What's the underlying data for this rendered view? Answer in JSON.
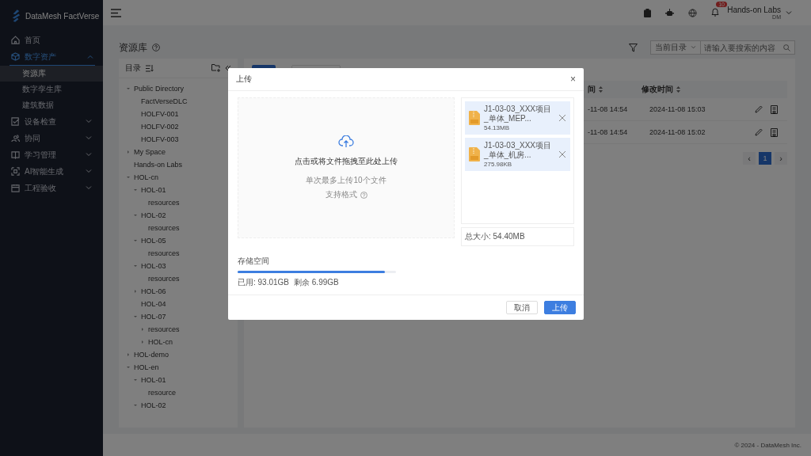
{
  "brand": {
    "name": "DataMesh FactVerse"
  },
  "nav": [
    {
      "label": "首页",
      "selected": false
    },
    {
      "label": "数字资产",
      "expanded": true,
      "selected": true,
      "children": [
        {
          "label": "资源库",
          "selected": true
        },
        {
          "label": "数字孪生库",
          "selected": false
        },
        {
          "label": "建筑数据",
          "selected": false
        }
      ]
    },
    {
      "label": "设备检查",
      "expanded": false,
      "selected": false
    },
    {
      "label": "协同",
      "expanded": false,
      "selected": false
    },
    {
      "label": "学习管理",
      "expanded": false,
      "selected": false
    },
    {
      "label": "AI智能生成",
      "expanded": false,
      "selected": false
    },
    {
      "label": "工程验收",
      "expanded": false,
      "selected": false
    }
  ],
  "header": {
    "notification_count": "10",
    "user": "Hands-on Labs",
    "user_sub": "DM"
  },
  "page": {
    "title": "资源库",
    "scope_select": "当前目录",
    "search": {
      "placeholder": "请输入要搜索的内容"
    }
  },
  "tree": {
    "title": "目录",
    "items": [
      {
        "label": "Public Directory",
        "expanded": true,
        "children": [
          {
            "label": "FactVerseDLC"
          },
          {
            "label": "HOLFV-001"
          },
          {
            "label": "HOLFV-002"
          },
          {
            "label": "HOLFV-003"
          }
        ]
      },
      {
        "label": "My Space",
        "expanded": false
      },
      {
        "label": "Hands-on Labs"
      },
      {
        "label": "HOL-cn",
        "expanded": true,
        "children": [
          {
            "label": "HOL-01",
            "expanded": true,
            "children": [
              {
                "label": "resources"
              }
            ]
          },
          {
            "label": "HOL-02",
            "expanded": true,
            "children": [
              {
                "label": "resources"
              }
            ]
          },
          {
            "label": "HOL-05",
            "expanded": true,
            "children": [
              {
                "label": "resources"
              }
            ]
          },
          {
            "label": "HOL-03",
            "expanded": true,
            "children": [
              {
                "label": "resources"
              }
            ]
          },
          {
            "label": "HOL-06",
            "expanded": false
          },
          {
            "label": "HOL-04"
          },
          {
            "label": "HOL-07",
            "expanded": true,
            "children": [
              {
                "label": "resources",
                "expanded": false
              },
              {
                "label": "HOL-cn",
                "expanded": false
              }
            ]
          }
        ]
      },
      {
        "label": "HOL-demo",
        "expanded": false
      },
      {
        "label": "HOL-en",
        "expanded": true,
        "children": [
          {
            "label": "HOL-01",
            "expanded": true,
            "children": [
              {
                "label": "resource"
              }
            ]
          },
          {
            "label": "HOL-02",
            "expanded": true
          }
        ]
      }
    ]
  },
  "table": {
    "columns": [
      "间",
      "修改时间"
    ],
    "rows": [
      {
        "column_1": "-11-08 14:54",
        "modified": "2024-11-08 15:03"
      },
      {
        "column_1": "-11-08 14:54",
        "modified": "2024-11-08 15:02"
      }
    ]
  },
  "pagination": {
    "prev": "‹",
    "pages": [
      {
        "label": "1",
        "selected": true
      }
    ],
    "next": "›"
  },
  "footer": "© 2024 - DataMesh Inc.",
  "dialog": {
    "title": "上传",
    "close": "×",
    "drop_text": "点击或将文件拖拽至此处上传",
    "limit": "单次最多上传10个文件",
    "formats": "支持格式",
    "files": [
      {
        "name": "J1-03-03_XXX项目_单体_MEP...",
        "size": "54.13MB"
      },
      {
        "name": "J1-03-03_XXX项目_单体_机房...",
        "size": "275.98KB"
      }
    ],
    "total": "总大小: 54.40MB",
    "storage_label": "存储空间",
    "storage": {
      "level": 0.93
    },
    "used": "已用: 93.01GB",
    "remaining": "剩余 6.99GB",
    "buttons": [
      {
        "label": "取消",
        "kind": "default"
      },
      {
        "label": "上传",
        "kind": "primary"
      }
    ]
  }
}
